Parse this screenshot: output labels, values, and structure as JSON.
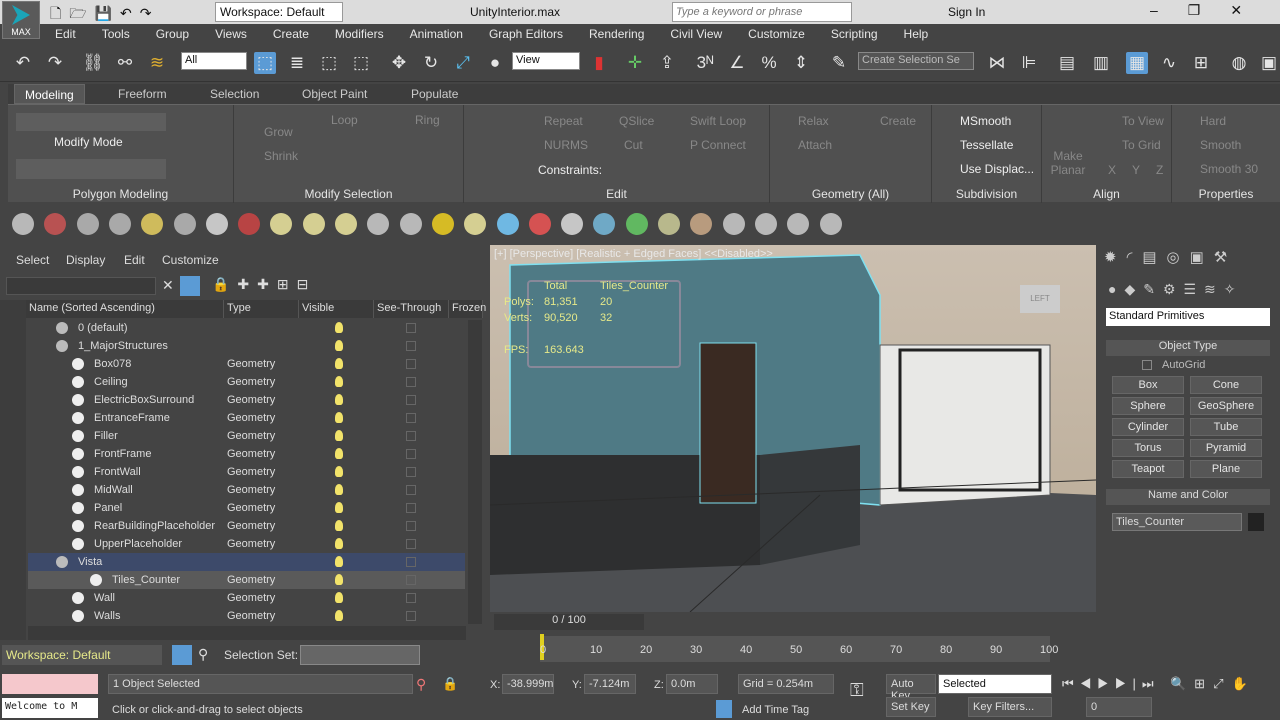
{
  "title_bar": {
    "logo": "MAX",
    "workspace": "Workspace: Default",
    "file_title": "UnityInterior.max",
    "search_placeholder": "Type a keyword or phrase",
    "sign_in": "Sign In"
  },
  "menu": [
    "Edit",
    "Tools",
    "Group",
    "Views",
    "Create",
    "Modifiers",
    "Animation",
    "Graph Editors",
    "Rendering",
    "Civil View",
    "Customize",
    "Scripting",
    "Help"
  ],
  "toolbar": {
    "filter": "All",
    "ref_coord": "View",
    "selection_set": "Create Selection Se"
  },
  "ribbon": {
    "tabs": [
      "Modeling",
      "Freeform",
      "Selection",
      "Object Paint",
      "Populate"
    ],
    "groups": {
      "polygon_modeling": "Polygon Modeling",
      "modify_mode": "Modify Mode",
      "modify_selection": "Modify Selection",
      "edit": "Edit",
      "geometry": "Geometry (All)",
      "subdivision": "Subdivision",
      "align": "Align",
      "properties": "Properties"
    },
    "modsel": [
      "Grow",
      "Shrink",
      "Loop",
      "Ring"
    ],
    "edit": [
      "Repeat",
      "QSlice",
      "Swift Loop",
      "NURMS",
      "Cut",
      "P Connect",
      "Constraints:"
    ],
    "geometry": [
      "Relax",
      "Create",
      "Attach"
    ],
    "subdivision": [
      "MSmooth",
      "Tessellate",
      "Use Displac..."
    ],
    "align": [
      "Make Planar",
      "To View",
      "To Grid",
      "X",
      "Y",
      "Z"
    ],
    "properties": [
      "Hard",
      "Smooth",
      "Smooth 30"
    ]
  },
  "explorer": {
    "menu": [
      "Select",
      "Display",
      "Edit",
      "Customize"
    ],
    "columns": [
      "Name (Sorted Ascending)",
      "Type",
      "Visible",
      "See-Through",
      "Frozen"
    ],
    "rows": [
      {
        "name": "0 (default)",
        "type": "",
        "level": 0,
        "layer": true
      },
      {
        "name": "1_MajorStructures",
        "type": "",
        "level": 0,
        "layer": true
      },
      {
        "name": "Box078",
        "type": "Geometry",
        "level": 1
      },
      {
        "name": "Ceiling",
        "type": "Geometry",
        "level": 1,
        "st": true
      },
      {
        "name": "ElectricBoxSurround",
        "type": "Geometry",
        "level": 1
      },
      {
        "name": "EntranceFrame",
        "type": "Geometry",
        "level": 1
      },
      {
        "name": "Filler",
        "type": "Geometry",
        "level": 1,
        "st": true
      },
      {
        "name": "FrontFrame",
        "type": "Geometry",
        "level": 1
      },
      {
        "name": "FrontWall",
        "type": "Geometry",
        "level": 1,
        "st": true
      },
      {
        "name": "MidWall",
        "type": "Geometry",
        "level": 1
      },
      {
        "name": "Panel",
        "type": "Geometry",
        "level": 1
      },
      {
        "name": "RearBuildingPlaceholder",
        "type": "Geometry",
        "level": 1
      },
      {
        "name": "UpperPlaceholder",
        "type": "Geometry",
        "level": 1
      },
      {
        "name": "Vista",
        "type": "",
        "level": 0,
        "layer": true,
        "hl": true
      },
      {
        "name": "Tiles_Counter",
        "type": "Geometry",
        "level": 2,
        "sel": true
      },
      {
        "name": "Wall",
        "type": "Geometry",
        "level": 1
      },
      {
        "name": "Walls",
        "type": "Geometry",
        "level": 1
      }
    ],
    "workspace": "Workspace: Default",
    "selection_set_label": "Selection Set:"
  },
  "viewport": {
    "label": "[+] [Perspective] [Realistic + Edged Faces]  <<Disabled>>",
    "stats": {
      "h1": "Total",
      "h2": "Tiles_Counter",
      "polys_label": "Polys:",
      "polys_total": "81,351",
      "polys_sel": "20",
      "verts_label": "Verts:",
      "verts_total": "90,520",
      "verts_sel": "32",
      "fps_label": "FPS:",
      "fps": "163.643"
    },
    "viewcube": "LEFT"
  },
  "command_panel": {
    "category": "Standard Primitives",
    "object_type": "Object Type",
    "autogrid": "AutoGrid",
    "buttons": [
      "Box",
      "Cone",
      "Sphere",
      "GeoSphere",
      "Cylinder",
      "Tube",
      "Torus",
      "Pyramid",
      "Teapot",
      "Plane"
    ],
    "name_color": "Name and Color",
    "object_name": "Tiles_Counter",
    "object_color": "#222222"
  },
  "timeline": {
    "frame": "0 / 100",
    "ticks": [
      "0",
      "10",
      "20",
      "30",
      "40",
      "50",
      "60",
      "70",
      "80",
      "90",
      "100"
    ]
  },
  "status": {
    "maxscript": "Welcome to M",
    "selected": "1 Object Selected",
    "prompt": "Click or click-and-drag to select objects",
    "x": "-38.999m",
    "y": "-7.124m",
    "z": "0.0m",
    "grid": "Grid = 0.254m",
    "add_time_tag": "Add Time Tag",
    "auto_key": "Auto Key",
    "set_key": "Set Key",
    "key_mode": "Selected",
    "key_filters": "Key Filters...",
    "current_frame": "0"
  }
}
